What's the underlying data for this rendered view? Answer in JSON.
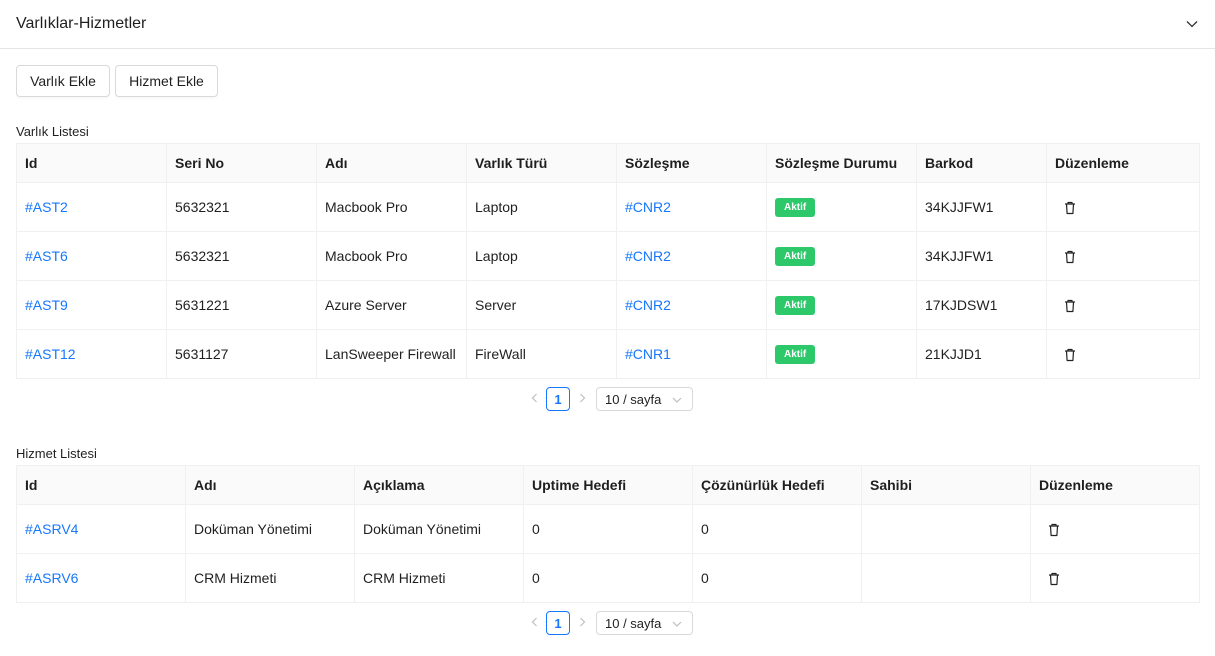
{
  "panel": {
    "title": "Varlıklar-Hizmetler"
  },
  "buttons": {
    "add_asset": "Varlık Ekle",
    "add_service": "Hizmet Ekle"
  },
  "assets": {
    "label": "Varlık Listesi",
    "columns": [
      "Id",
      "Seri No",
      "Adı",
      "Varlık Türü",
      "Sözleşme",
      "Sözleşme Durumu",
      "Barkod",
      "Düzenleme"
    ],
    "rows": [
      {
        "id": "#AST2",
        "serial": "5632321",
        "name": "Macbook Pro",
        "type": "Laptop",
        "contract": "#CNR2",
        "status": "Aktif",
        "barcode": "34KJJFW1"
      },
      {
        "id": "#AST6",
        "serial": "5632321",
        "name": "Macbook Pro",
        "type": "Laptop",
        "contract": "#CNR2",
        "status": "Aktif",
        "barcode": "34KJJFW1"
      },
      {
        "id": "#AST9",
        "serial": "5631221",
        "name": "Azure Server",
        "type": "Server",
        "contract": "#CNR2",
        "status": "Aktif",
        "barcode": "17KJDSW1"
      },
      {
        "id": "#AST12",
        "serial": "5631127",
        "name": "LanSweeper Firewall",
        "type": "FireWall",
        "contract": "#CNR1",
        "status": "Aktif",
        "barcode": "21KJJD1"
      }
    ],
    "pagination": {
      "page": "1",
      "size": "10 / sayfa"
    }
  },
  "services": {
    "label": "Hizmet Listesi",
    "columns": [
      "Id",
      "Adı",
      "Açıklama",
      "Uptime Hedefi",
      "Çözünürlük Hedefi",
      "Sahibi",
      "Düzenleme"
    ],
    "rows": [
      {
        "id": "#ASRV4",
        "name": "Doküman Yönetimi",
        "description": "Doküman Yönetimi",
        "uptime": "0",
        "resolution": "0",
        "owner": ""
      },
      {
        "id": "#ASRV6",
        "name": "CRM Hizmeti",
        "description": "CRM Hizmeti",
        "uptime": "0",
        "resolution": "0",
        "owner": ""
      }
    ],
    "pagination": {
      "page": "1",
      "size": "10 / sayfa"
    }
  },
  "colors": {
    "link": "#1677ff",
    "badge_active": "#2dc86a",
    "header_bg": "#fafafa",
    "border": "#f0f0f0"
  },
  "icons": {
    "collapse": "chevron-down-icon",
    "delete": "trash-icon",
    "prev": "chevron-left-icon",
    "next": "chevron-right-icon",
    "select": "chevron-down-icon"
  }
}
